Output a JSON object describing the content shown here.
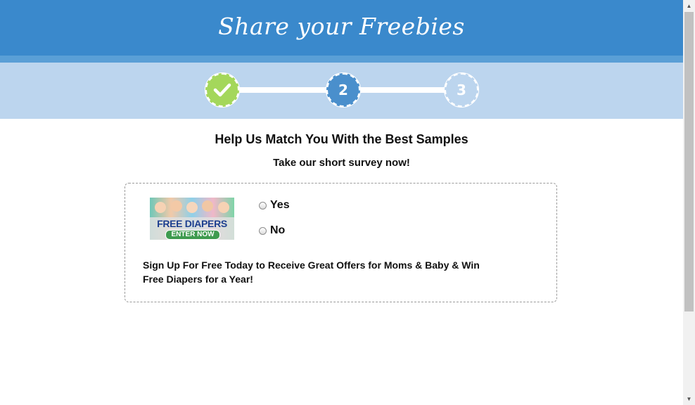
{
  "header": {
    "title": "Share your Freebies"
  },
  "steps": [
    {
      "label": "",
      "state": "complete",
      "icon": "check-icon",
      "color": "#a4d75b"
    },
    {
      "label": "2",
      "state": "current",
      "color": "#4a8fcc"
    },
    {
      "label": "3",
      "state": "upcoming",
      "color": "#bcd5ee"
    }
  ],
  "main": {
    "title": "Help Us Match You With the Best Samples",
    "subtitle": "Take our short survey now!"
  },
  "offer": {
    "ad_title": "FREE DIAPERS",
    "ad_button": "ENTER NOW",
    "options": [
      {
        "label": "Yes",
        "selected": false
      },
      {
        "label": "No",
        "selected": false
      }
    ],
    "description": "Sign Up For Free Today to Receive Great Offers for Moms & Baby & Win Free Diapers for a Year!"
  },
  "colors": {
    "header": "#3a89cc",
    "steps_band": "#bcd5ee",
    "accent_green": "#a4d75b"
  }
}
